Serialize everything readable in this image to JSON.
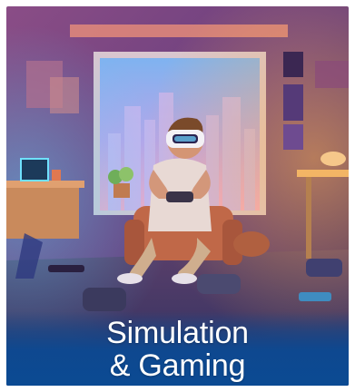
{
  "card": {
    "title_line1": "Simulation",
    "title_line2": "& Gaming"
  },
  "image": {
    "subject": "vr-gamer-room-illustration"
  },
  "colors": {
    "caption_bg": "#0b4a93",
    "caption_text": "#ffffff"
  }
}
